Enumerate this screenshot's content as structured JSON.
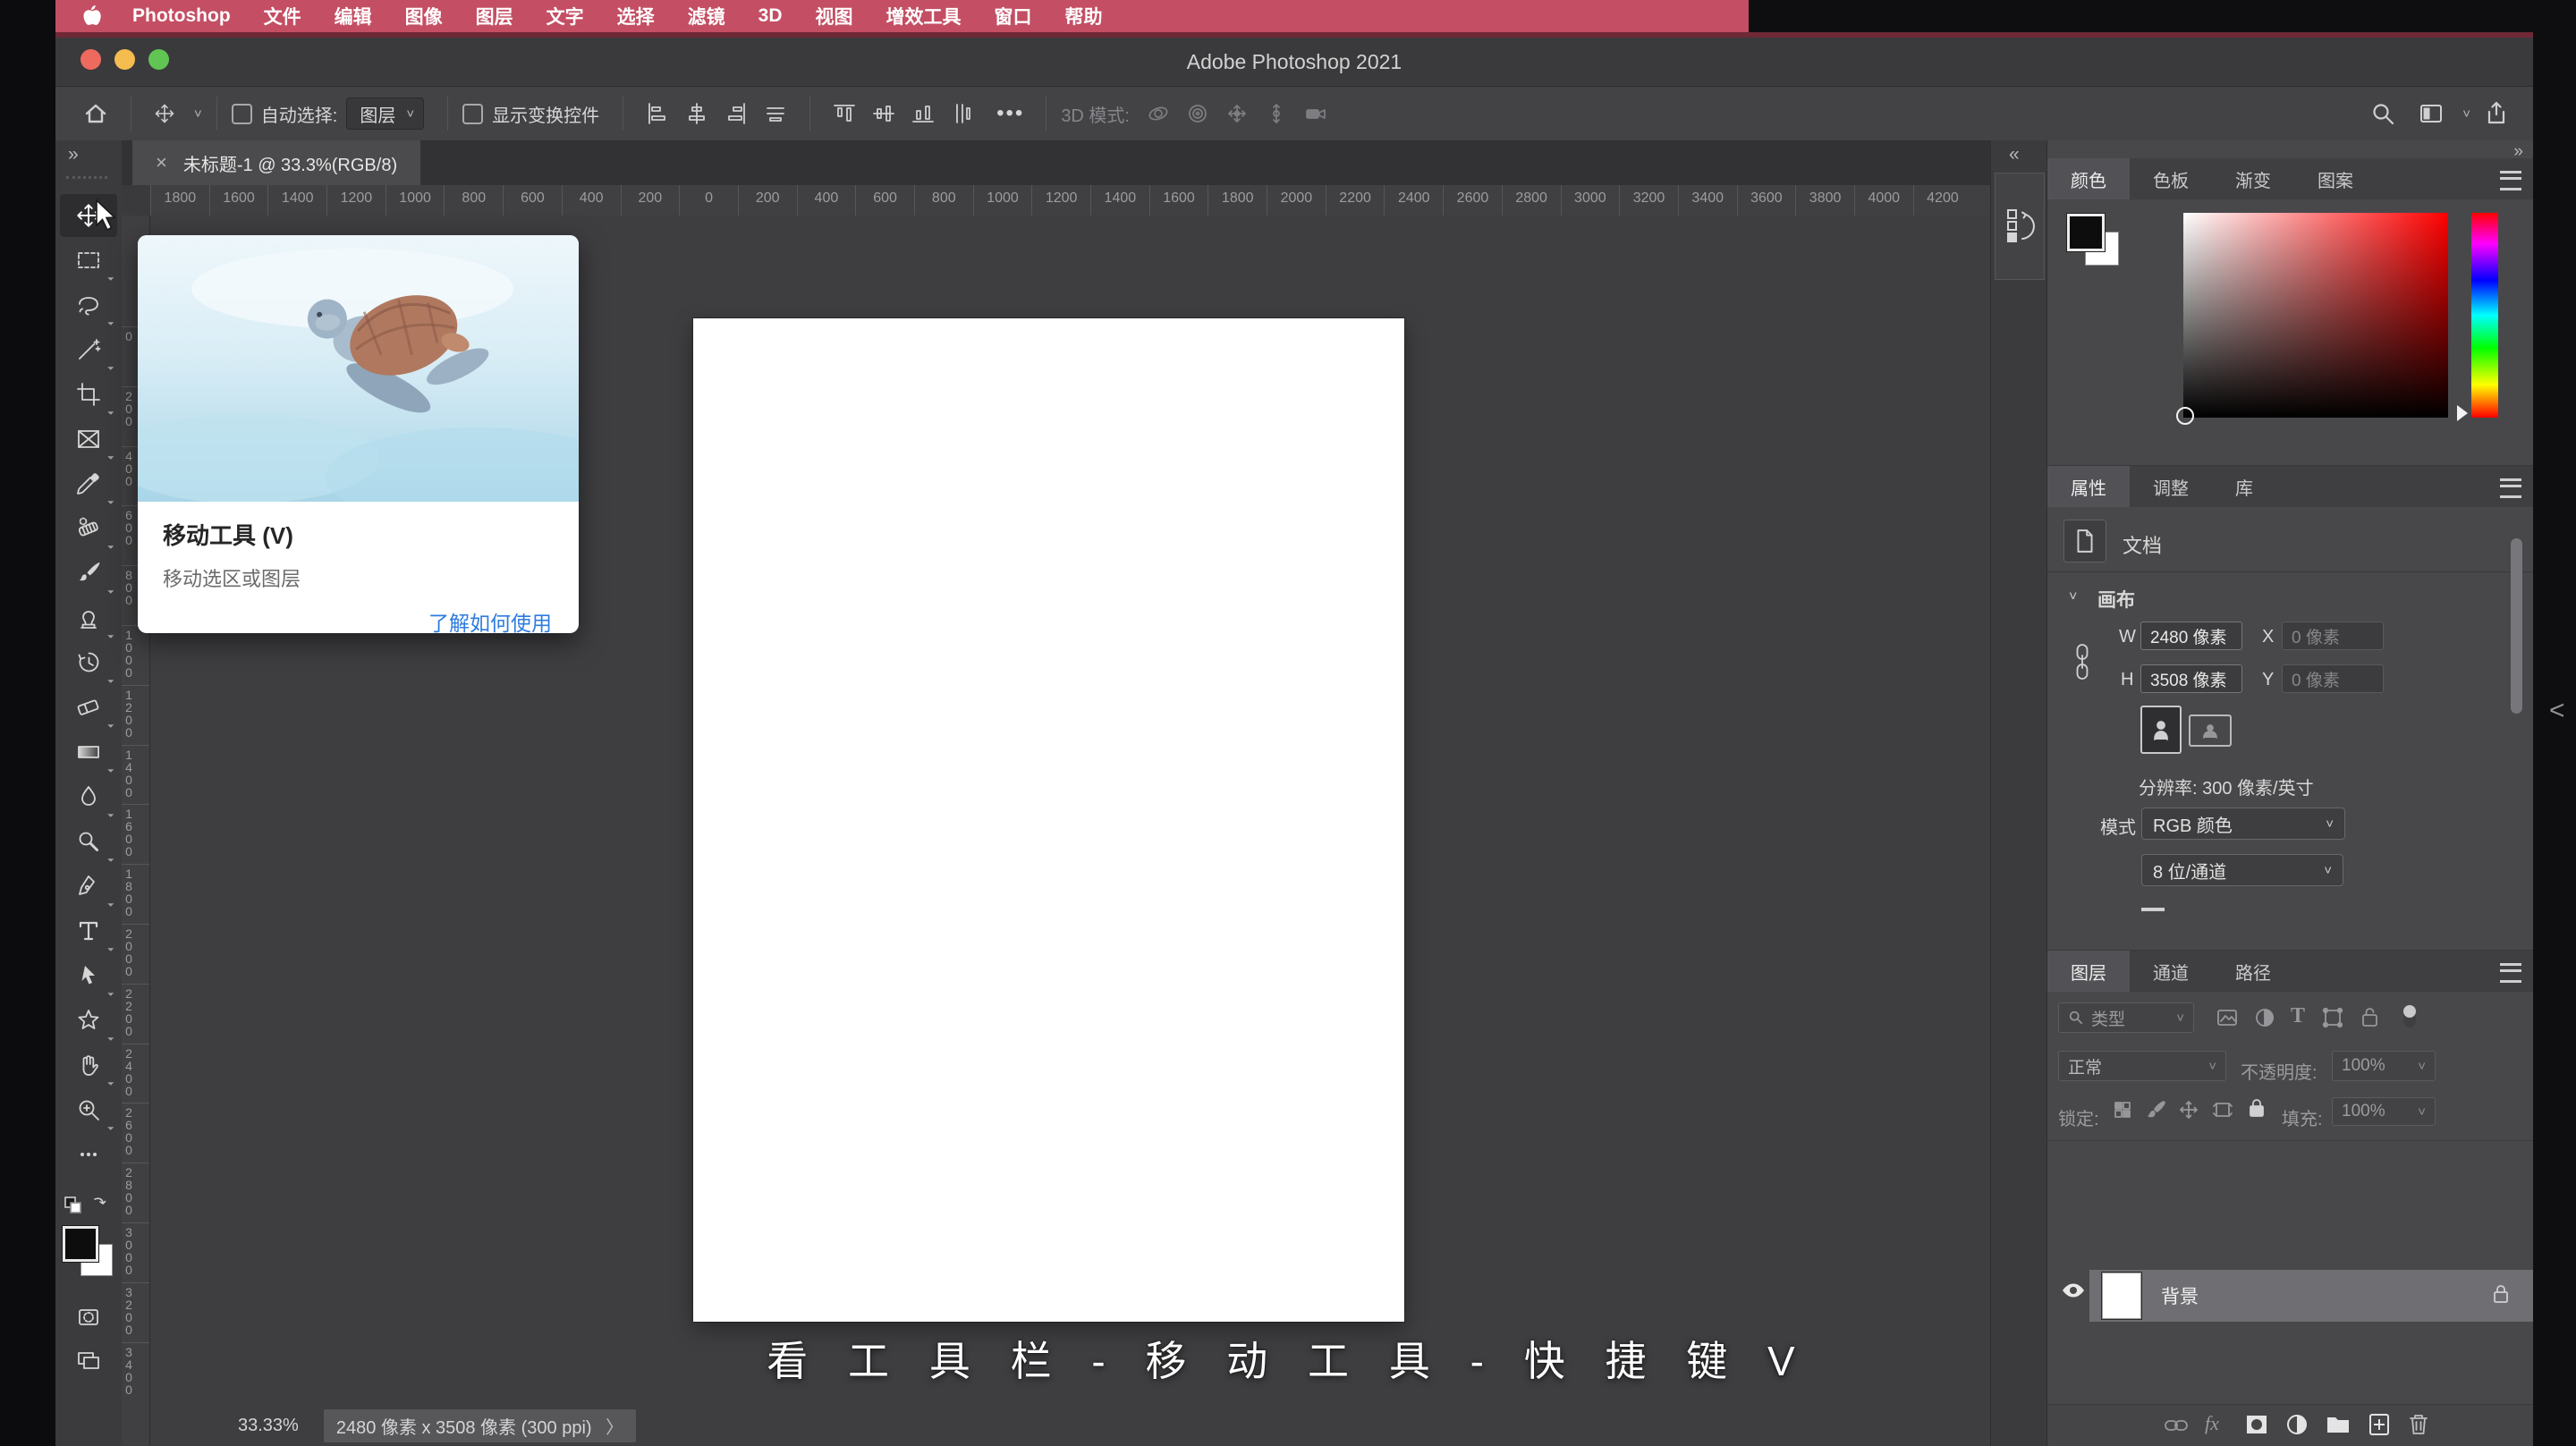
{
  "app": {
    "menubar": {
      "apple_icon": "apple-logo",
      "items": [
        "Photoshop",
        "文件",
        "编辑",
        "图像",
        "图层",
        "文字",
        "选择",
        "滤镜",
        "3D",
        "视图",
        "增效工具",
        "窗口",
        "帮助"
      ]
    },
    "titlebar": {
      "title": "Adobe Photoshop 2021"
    }
  },
  "options_bar": {
    "auto_select_label": "自动选择:",
    "auto_select_value": "图层",
    "show_transform_label": "显示变换控件",
    "more": "•••",
    "mode_3d_label": "3D 模式:"
  },
  "document": {
    "tab_close": "×",
    "tab_label": "未标题-1 @ 33.3%(RGB/8)",
    "status_zoom": "33.33%",
    "status_info": "2480 像素 x 3508 像素 (300 ppi)",
    "status_chevron": "〉"
  },
  "rulers": {
    "horizontal": [
      "1800",
      "1600",
      "1400",
      "1200",
      "1000",
      "800",
      "600",
      "400",
      "200",
      "0",
      "200",
      "400",
      "600",
      "800",
      "1000",
      "1200",
      "1400",
      "1600",
      "1800",
      "2000",
      "2200",
      "2400",
      "2600",
      "2800",
      "3000",
      "3200",
      "3400",
      "3600",
      "3800",
      "4000",
      "4200"
    ],
    "vertical": [
      "0",
      "200",
      "400",
      "600",
      "800",
      "1000",
      "1200",
      "1400",
      "1600",
      "1800",
      "2000",
      "2200",
      "2400",
      "2600",
      "2800",
      "3000",
      "3200",
      "3400"
    ]
  },
  "tool_tooltip": {
    "title": "移动工具 (V)",
    "description": "移动选区或图层",
    "link": "了解如何使用",
    "image": "sea-turtle-watercolor"
  },
  "tools": [
    "move",
    "rectangular-marquee",
    "lasso",
    "object-selection",
    "crop",
    "frame",
    "eyedropper",
    "spot-healing-brush",
    "brush",
    "clone-stamp",
    "history-brush",
    "eraser",
    "gradient",
    "blur",
    "dodge",
    "pen",
    "type",
    "path-selection",
    "custom-shape",
    "hand",
    "zoom",
    "edit-toolbar"
  ],
  "panels": {
    "collapsed_strip": {
      "expand_arrows": "«",
      "icon": "history-panel-icon"
    },
    "dock": {
      "collapse_arrows": "»"
    },
    "toolbar_expand_arrows": "»",
    "color": {
      "tabs": [
        "颜色",
        "色板",
        "渐变",
        "图案"
      ],
      "active_tab": "颜色"
    },
    "properties": {
      "tabs": [
        "属性",
        "调整",
        "库"
      ],
      "active_tab": "属性",
      "document_label": "文档",
      "canvas_label": "画布",
      "w_label": "W",
      "w_value": "2480 像素",
      "x_label": "X",
      "x_value": "0 像素",
      "h_label": "H",
      "h_value": "3508 像素",
      "y_label": "Y",
      "y_value": "0 像素",
      "resolution": "分辨率: 300 像素/英寸",
      "mode_label": "模式",
      "mode_value": "RGB 颜色",
      "depth_value": "8 位/通道"
    },
    "layers": {
      "tabs": [
        "图层",
        "通道",
        "路径"
      ],
      "active_tab": "图层",
      "filter_label": "类型",
      "blend_mode": "正常",
      "opacity_label": "不透明度:",
      "opacity_value": "100%",
      "lock_label": "锁定:",
      "fill_label": "填充:",
      "fill_value": "100%",
      "background_layer_name": "背景"
    }
  },
  "caption": "看 工 具 栏 - 移 动 工 具 - 快 捷 键  V",
  "colors": {
    "menubar_red": "#c44e63",
    "link_blue": "#2e7ce0",
    "traffic_red": "#ee6a5f",
    "traffic_yellow": "#f5bd4f",
    "traffic_green": "#61c554",
    "selected_layer_row": "#6f6f73"
  }
}
